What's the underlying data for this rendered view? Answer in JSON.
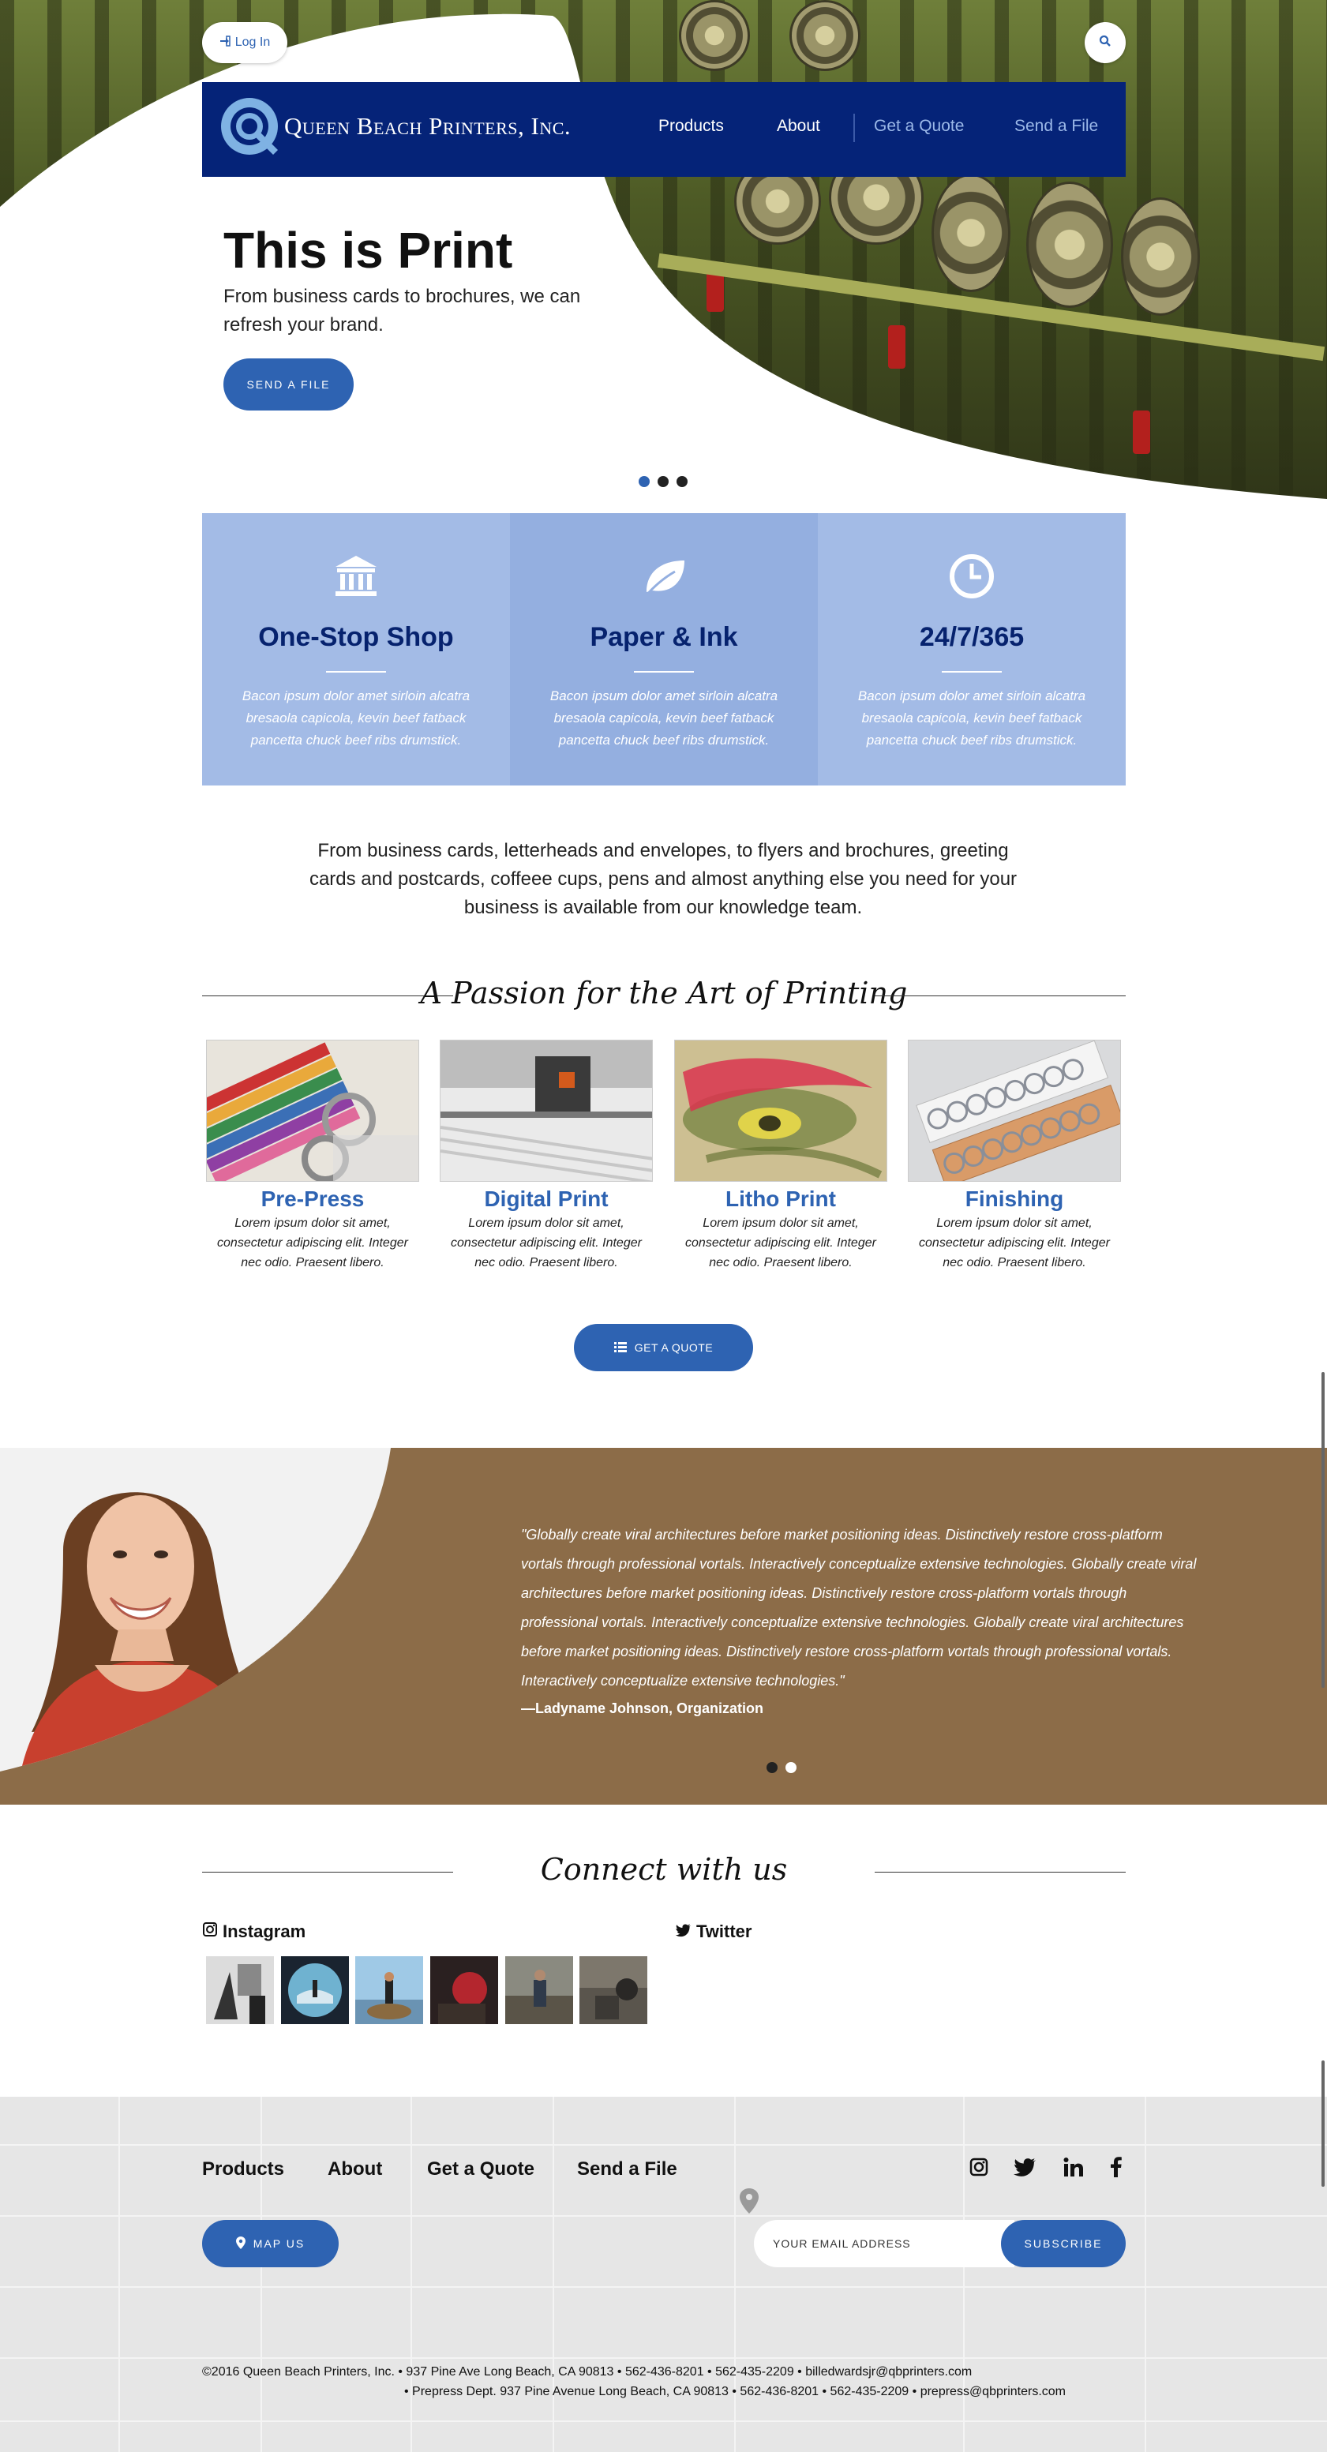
{
  "header": {
    "login_label": "Log In",
    "brand": "Queen Beach Printers, Inc.",
    "nav": [
      {
        "label": "Products"
      },
      {
        "label": "About"
      },
      {
        "label": "Get a Quote"
      },
      {
        "label": "Send a File"
      }
    ]
  },
  "hero": {
    "title": "This is Print",
    "subtitle": "From business cards to brochures, we can refresh your brand.",
    "cta": "SEND A FILE",
    "slide_count": 3,
    "active_slide": 1
  },
  "features": [
    {
      "icon": "bank-icon",
      "title": "One-Stop Shop",
      "text": "Bacon ipsum dolor amet sirloin alcatra bresaola capicola, kevin beef fatback pancetta chuck beef ribs drumstick."
    },
    {
      "icon": "leaf-icon",
      "title": "Paper & Ink",
      "text": "Bacon ipsum dolor amet sirloin alcatra bresaola capicola, kevin beef fatback pancetta chuck beef ribs drumstick."
    },
    {
      "icon": "clock-icon",
      "title": "24/7/365",
      "text": "Bacon ipsum dolor amet sirloin alcatra bresaola capicola, kevin beef fatback pancetta chuck beef ribs drumstick."
    }
  ],
  "intro": "From business cards, letterheads and envelopes, to flyers and brochures, greeting cards and postcards, coffeee cups, pens and almost anything else you need for your business is available from our knowledge team.",
  "passion_heading": "A Passion for the Art of Printing",
  "services": [
    {
      "title": "Pre-Press",
      "text": "Lorem ipsum dolor sit amet, consectetur adipiscing elit. Integer nec odio. Praesent libero."
    },
    {
      "title": "Digital Print",
      "text": "Lorem ipsum dolor sit amet, consectetur adipiscing elit. Integer nec odio. Praesent libero."
    },
    {
      "title": "Litho Print",
      "text": "Lorem ipsum dolor sit amet, consectetur adipiscing elit. Integer nec odio. Praesent libero."
    },
    {
      "title": "Finishing",
      "text": "Lorem ipsum dolor sit amet, consectetur adipiscing elit. Integer nec odio. Praesent libero."
    }
  ],
  "quote_button": "GET A QUOTE",
  "testimonial": {
    "quote": "\"Globally create viral architectures before market positioning ideas. Distinctively restore cross-platform vortals through professional vortals. Interactively conceptualize extensive technologies. Globally create viral architectures before market positioning ideas. Distinctively restore cross-platform vortals through professional vortals. Interactively conceptualize extensive technologies. Globally create viral architectures before market positioning ideas. Distinctively restore cross-platform vortals through professional vortals. Interactively conceptualize extensive technologies.\"",
    "author": "—Ladyname Johnson, Organization"
  },
  "connect": {
    "heading": "Connect with us",
    "instagram_label": "Instagram",
    "twitter_label": "Twitter"
  },
  "footer": {
    "links": [
      {
        "label": "Products"
      },
      {
        "label": "About"
      },
      {
        "label": "Get a Quote"
      },
      {
        "label": "Send a File"
      }
    ],
    "social_icons": [
      "instagram-icon",
      "twitter-icon",
      "linkedin-icon",
      "facebook-icon"
    ],
    "map_button": "MAP US",
    "email_placeholder": "YOUR EMAIL ADDRESS",
    "subscribe": "SUBSCRIBE",
    "line1": "©2016 Queen Beach Printers, Inc. • 937 Pine Ave  Long Beach, CA 90813 • 562-436-8201 • 562-435-2209 • billedwardsjr@qbprinters.com",
    "line2": "• Prepress Dept.  937 Pine Avenue  Long Beach, CA 90813 • 562-436-8201 • 562-435-2209 • prepress@qbprinters.com"
  },
  "colors": {
    "navy": "#052378",
    "accent": "#2e63b2",
    "feature_bg": "#a3bbe6",
    "testimonial_bg": "#8c6c48"
  }
}
